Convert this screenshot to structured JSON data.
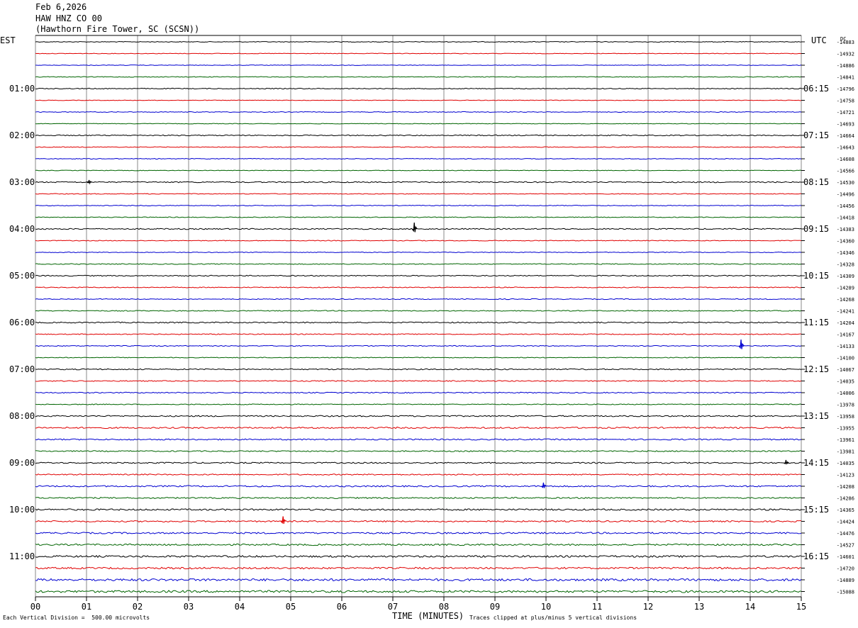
{
  "header": {
    "date": "Feb 6,2026",
    "station": "HAW HNZ CO 00",
    "location": "(Hawthorn Fire Tower, SC (SCSN))",
    "left_zone": "EST",
    "right_zone": "UTC",
    "dc_label": "DC"
  },
  "footer": {
    "scale_note": "Each Vertical Division =  500.00 microvolts",
    "xlabel": "TIME (MINUTES)",
    "clip_note": "Traces clipped at plus/minus 5 vertical divisions"
  },
  "chart_data": {
    "type": "line",
    "title": "HAW HNZ CO 00",
    "xlabel": "TIME (MINUTES)",
    "xlim": [
      0,
      15
    ],
    "x_ticks": [
      "00",
      "01",
      "02",
      "03",
      "04",
      "05",
      "06",
      "07",
      "08",
      "09",
      "10",
      "11",
      "12",
      "13",
      "14",
      "15"
    ],
    "trace_colors": [
      "#000000",
      "#e00000",
      "#0000d0",
      "#006400"
    ],
    "left_hour_labels": [
      "01:00",
      "02:00",
      "03:00",
      "04:00",
      "05:00",
      "06:00",
      "07:00",
      "08:00",
      "09:00",
      "10:00",
      "11:00"
    ],
    "right_hour_labels": [
      "06:15",
      "07:15",
      "08:15",
      "09:15",
      "10:15",
      "11:15",
      "12:15",
      "13:15",
      "14:15",
      "15:15",
      "16:15"
    ],
    "dc_offsets": [
      "-14883",
      "-14932",
      "-14886",
      "-14841",
      "-14796",
      "-14758",
      "-14721",
      "-14693",
      "-14664",
      "-14643",
      "-14608",
      "-14566",
      "-14530",
      "-14496",
      "-14456",
      "-14418",
      "-14383",
      "-14360",
      "-14346",
      "-14328",
      "-14309",
      "-14289",
      "-14268",
      "-14241",
      "-14204",
      "-14167",
      "-14133",
      "-14100",
      "-14067",
      "-14035",
      "-14006",
      "-13978",
      "-13958",
      "-13955",
      "-13961",
      "-13981",
      "-14035",
      "-14123",
      "-14208",
      "-14286",
      "-14365",
      "-14424",
      "-14476",
      "-14527",
      "-14601",
      "-14720",
      "-14889",
      "-15088"
    ],
    "trace_noise": [
      0.5,
      0.4,
      0.4,
      0.5,
      0.6,
      0.4,
      0.5,
      0.4,
      0.7,
      0.5,
      0.5,
      0.4,
      0.8,
      0.5,
      0.5,
      0.5,
      0.8,
      0.5,
      0.5,
      0.6,
      0.7,
      0.6,
      0.6,
      0.6,
      0.8,
      0.6,
      0.6,
      0.5,
      0.8,
      0.7,
      0.7,
      0.6,
      0.9,
      1.0,
      0.9,
      0.8,
      0.9,
      0.8,
      1.0,
      0.9,
      1.1,
      1.0,
      1.1,
      1.1,
      1.3,
      1.2,
      1.6,
      1.5
    ],
    "events": [
      {
        "trace": 12,
        "minute": 1.05,
        "amplitude": 3
      },
      {
        "trace": 16,
        "minute": 7.42,
        "amplitude": 9
      },
      {
        "trace": 26,
        "minute": 13.82,
        "amplitude": 9
      },
      {
        "trace": 41,
        "minute": 4.85,
        "amplitude": 7
      },
      {
        "trace": 38,
        "minute": 9.95,
        "amplitude": 5
      },
      {
        "trace": 36,
        "minute": 14.7,
        "amplitude": 4
      }
    ]
  }
}
